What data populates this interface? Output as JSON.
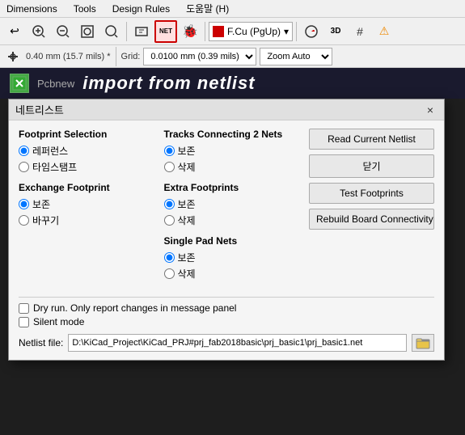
{
  "menubar": {
    "items": [
      "Dimensions",
      "Tools",
      "Design Rules",
      "도움말 (H)"
    ]
  },
  "toolbar": {
    "buttons": [
      {
        "name": "undo",
        "icon": "↩",
        "label": "Undo"
      },
      {
        "name": "zoom-in",
        "icon": "🔍+",
        "label": "Zoom In"
      },
      {
        "name": "zoom-out",
        "icon": "🔍-",
        "label": "Zoom Out"
      },
      {
        "name": "zoom-fit",
        "icon": "⊞",
        "label": "Zoom Fit"
      },
      {
        "name": "zoom-area",
        "icon": "⊟",
        "label": "Zoom Area"
      },
      {
        "name": "netlist",
        "icon": "NET",
        "label": "Import Netlist",
        "active": true
      },
      {
        "name": "bug",
        "icon": "🐞",
        "label": "Bug"
      },
      {
        "name": "layer-select",
        "label": "F.Cu (PgUp)"
      },
      {
        "name": "highlight",
        "icon": "◐",
        "label": "Highlight"
      },
      {
        "name": "3d",
        "icon": "3D",
        "label": "3D View"
      },
      {
        "name": "grid-toggle",
        "icon": "#",
        "label": "Grid Toggle"
      },
      {
        "name": "warning",
        "icon": "⚠",
        "label": "Warning"
      }
    ]
  },
  "toolbar2": {
    "size_text": "0.40 mm (15.7 mils) *",
    "route_icon": "⊕",
    "grid_label": "Grid:",
    "grid_value": "0.0100 mm (0.39 mils)",
    "zoom_label": "Zoom Auto"
  },
  "app": {
    "name": "Pcbnew",
    "title": "import from netlist"
  },
  "dialog": {
    "title": "네트리스트",
    "close_label": "×",
    "sections": {
      "footprint_selection": {
        "label": "Footprint Selection",
        "options": [
          {
            "id": "ref",
            "label": "레퍼런스",
            "checked": true
          },
          {
            "id": "timestamp",
            "label": "타임스탬프",
            "checked": false
          }
        ]
      },
      "exchange_footprint": {
        "label": "Exchange Footprint",
        "options": [
          {
            "id": "keep",
            "label": "보존",
            "checked": true
          },
          {
            "id": "replace",
            "label": "바꾸기",
            "checked": false
          }
        ]
      },
      "tracks_connecting": {
        "label": "Tracks Connecting 2 Nets",
        "options": [
          {
            "id": "keep2",
            "label": "보존",
            "checked": true
          },
          {
            "id": "delete2",
            "label": "삭제",
            "checked": false
          }
        ]
      },
      "extra_footprints": {
        "label": "Extra Footprints",
        "options": [
          {
            "id": "keep3",
            "label": "보존",
            "checked": true
          },
          {
            "id": "delete3",
            "label": "삭제",
            "checked": false
          }
        ]
      },
      "single_pad_nets": {
        "label": "Single Pad Nets",
        "options": [
          {
            "id": "keep4",
            "label": "보존",
            "checked": true
          },
          {
            "id": "delete4",
            "label": "삭제",
            "checked": false
          }
        ]
      }
    },
    "buttons": {
      "read_netlist": "Read Current Netlist",
      "close": "닫기",
      "test_footprints": "Test Footprints",
      "rebuild": "Rebuild Board Connectivity"
    },
    "checkboxes": {
      "dry_run": "Dry run. Only report changes in message panel",
      "silent": "Silent mode"
    },
    "netlist": {
      "label": "Netlist file:",
      "value": "D:\\KiCad_Project\\KiCad_PRJ#prj_fab2018basic\\prj_basic1\\prj_basic1.net",
      "browse_icon": "📁"
    }
  }
}
